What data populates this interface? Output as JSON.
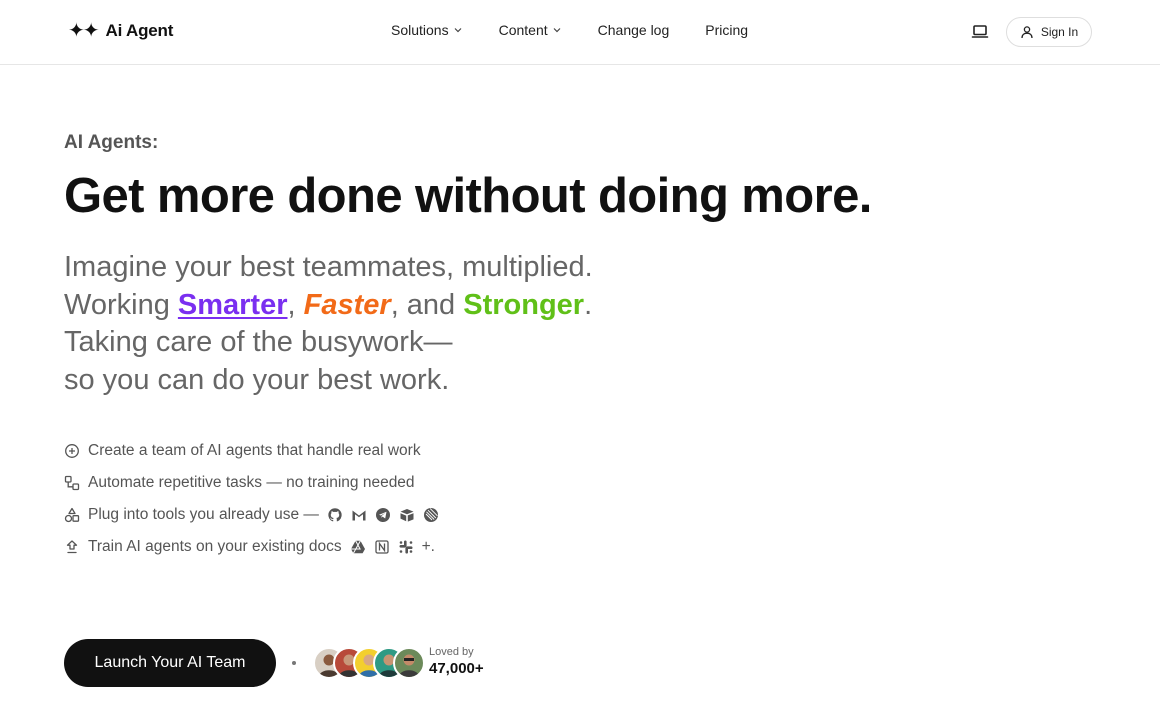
{
  "header": {
    "brand": {
      "glyph": "✦✦",
      "name": "Ai Agent"
    },
    "nav": [
      {
        "label": "Solutions",
        "has_dropdown": true
      },
      {
        "label": "Content",
        "has_dropdown": true
      },
      {
        "label": "Change log",
        "has_dropdown": false
      },
      {
        "label": "Pricing",
        "has_dropdown": false
      }
    ],
    "theme_icon": "laptop-icon",
    "signin_label": "Sign In"
  },
  "hero": {
    "eyebrow": "AI Agents:",
    "headline": "Get more done without doing more.",
    "lead": {
      "line1": "Imagine your best teammates, multiplied.",
      "working": "Working ",
      "smarter": "Smarter",
      "comma1": ", ",
      "faster": "Faster",
      "and": ", and ",
      "stronger": "Stronger",
      "period": ".",
      "line3": "Taking care of the busywork—",
      "line4": "so you can do your best work."
    },
    "colors": {
      "smarter": "#7a2ff0",
      "faster": "#f26a18",
      "stronger": "#60c018"
    }
  },
  "features": [
    {
      "icon": "plus-circle-icon",
      "text": "Create a team of AI agents that handle real work"
    },
    {
      "icon": "workflow-icon",
      "text": "Automate repetitive tasks — no training needed"
    },
    {
      "icon": "shapes-icon",
      "text": "Plug into tools you already use — ",
      "tools": [
        "github-icon",
        "gmail-icon",
        "telegram-icon",
        "airtable-icon",
        "linear-icon"
      ]
    },
    {
      "icon": "upload-icon",
      "text": "Train AI agents on your existing docs",
      "tools": [
        "google-drive-icon",
        "notion-icon",
        "slack-icon"
      ],
      "suffix": "+."
    }
  ],
  "cta": {
    "button_label": "Launch Your AI Team",
    "social_small": "Loved by",
    "social_count": "47,000+"
  }
}
